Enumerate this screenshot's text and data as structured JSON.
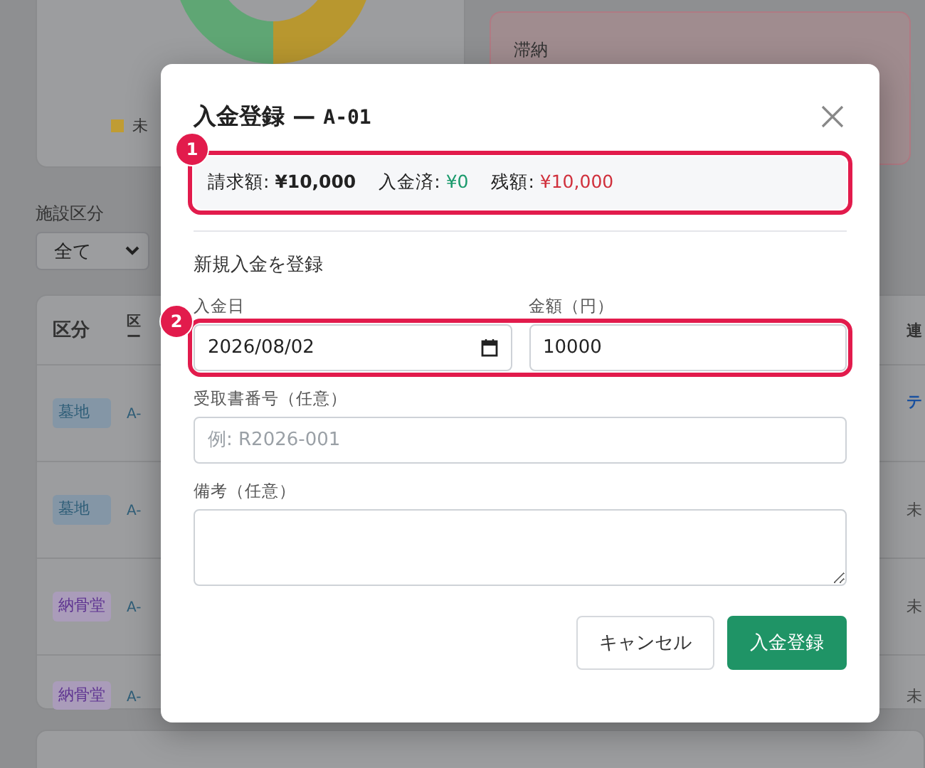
{
  "background": {
    "chart_legend": {
      "label": "未",
      "color": "#c09c33"
    },
    "alert_card": {
      "title": "滞納"
    },
    "filter": {
      "label": "施設区分",
      "value": "全て"
    },
    "table": {
      "columns": [
        "区分",
        "区ー",
        "連"
      ],
      "rows": [
        {
          "type": {
            "label": "墓地",
            "color": "#2f5e78"
          },
          "column_2": "A-",
          "column_3": {
            "kind": "link",
            "text": "テ"
          }
        },
        {
          "type": {
            "label": "墓地",
            "color": "#2f5e78"
          },
          "column_2": "A-",
          "column_3": {
            "kind": "plain",
            "text": "未"
          }
        },
        {
          "type": {
            "label": "納骨堂",
            "color": "#5e3391"
          },
          "column_2": "A-",
          "column_3": {
            "kind": "plain",
            "text": "未"
          }
        },
        {
          "type": {
            "label": "納骨堂",
            "color": "#5e3391"
          },
          "column_2": "A-",
          "column_3": {
            "kind": "plain",
            "text": "未"
          }
        }
      ]
    }
  },
  "dialog": {
    "title": "入金登録",
    "separator": "—",
    "code": "A-01",
    "summary": [
      {
        "kind": "billed",
        "label": "請求額:",
        "value": "¥10,000"
      },
      {
        "kind": "paid",
        "label": "入金済:",
        "value": "¥0"
      },
      {
        "kind": "balance",
        "label": "残額:",
        "value": "¥10,000"
      }
    ],
    "section_title": "新規入金を登録",
    "date_field": {
      "label": "入金日",
      "value": "2026/08/02"
    },
    "amount_field": {
      "label": "金額（円）",
      "value": "10000"
    },
    "receipt_field": {
      "label": "受取書番号（任意）",
      "placeholder": "例: R2026-001"
    },
    "note_field": {
      "label": "備考（任意）"
    },
    "buttons": [
      {
        "kind": "secondary",
        "label": "キャンセル"
      },
      {
        "kind": "primary",
        "label": "入金登録"
      }
    ]
  },
  "annotations": [
    "1",
    "2"
  ]
}
